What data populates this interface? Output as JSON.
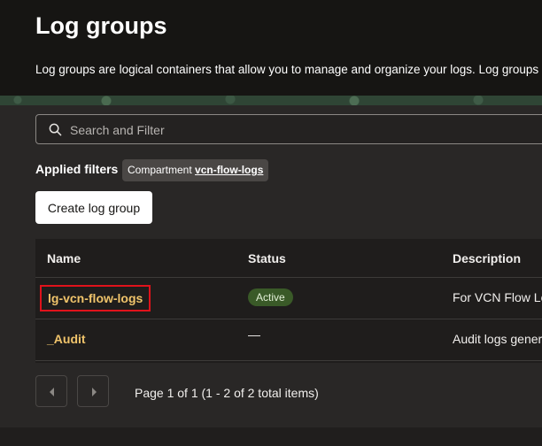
{
  "header": {
    "title": "Log groups",
    "description": "Log groups are logical containers that allow you to manage and organize your logs. Log groups"
  },
  "search": {
    "placeholder": "Search and Filter",
    "value": ""
  },
  "filters": {
    "label": "Applied filters",
    "chip": {
      "key": "Compartment",
      "value": "vcn-flow-logs"
    }
  },
  "actions": {
    "create_label": "Create log group"
  },
  "table": {
    "columns": [
      "Name",
      "Status",
      "Description"
    ],
    "rows": [
      {
        "name": "lg-vcn-flow-logs",
        "status": "Active",
        "description": "For VCN Flow Lo"
      },
      {
        "name": "_Audit",
        "status": "—",
        "description": "Audit logs genera"
      }
    ]
  },
  "pagination": {
    "text": "Page 1 of 1 (1 - 2 of 2 total items)"
  },
  "colors": {
    "header_bg": "#161513",
    "page_bg": "#292726",
    "link": "#f0c46b",
    "highlight_border": "#e0121b",
    "active_badge_bg": "#3a5a28"
  },
  "icons": {
    "search": "search-icon",
    "prev": "chevron-left-icon",
    "next": "chevron-right-icon"
  }
}
